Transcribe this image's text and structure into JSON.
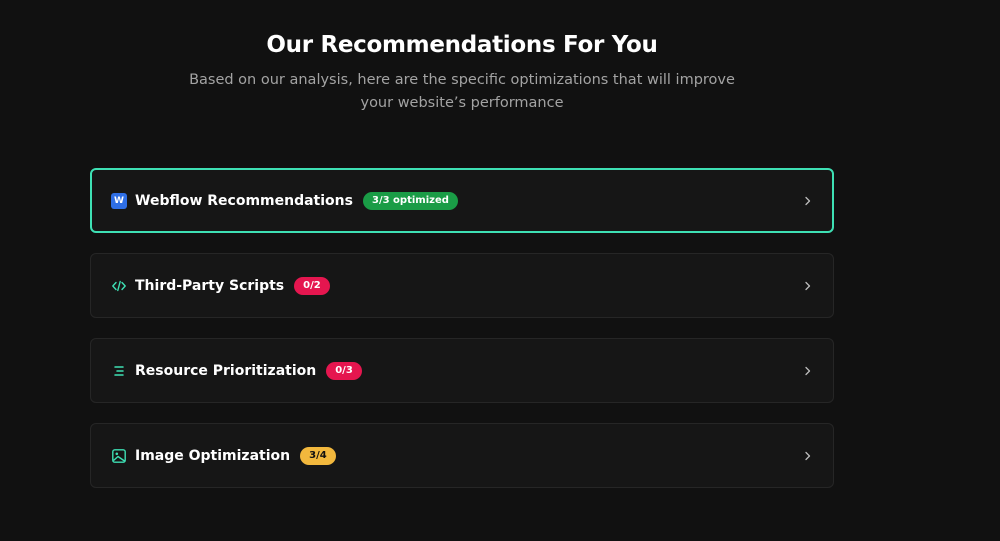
{
  "header": {
    "title": "Our Recommendations For You",
    "subtitle": "Based on our analysis, here are the specific optimizations that will improve your website’s performance"
  },
  "colors": {
    "background": "#111111",
    "card_background": "#161616",
    "active_border": "#3ee0b4",
    "icon_accent": "#3ee0b4",
    "badge_green": "#1a9c46",
    "badge_red": "#e5164f",
    "badge_amber": "#f2b83d"
  },
  "recommendations": [
    {
      "label": "Webflow Recommendations",
      "badge": "3/3 optimized",
      "status": "green",
      "icon": "webflow-logo-icon",
      "icon_text": "W",
      "active": true
    },
    {
      "label": "Third-Party Scripts",
      "badge": "0/2",
      "status": "red",
      "icon": "code-icon",
      "active": false
    },
    {
      "label": "Resource Prioritization",
      "badge": "0/3",
      "status": "red",
      "icon": "list-priority-icon",
      "active": false
    },
    {
      "label": "Image Optimization",
      "badge": "3/4",
      "status": "amber",
      "icon": "image-icon",
      "active": false
    }
  ]
}
